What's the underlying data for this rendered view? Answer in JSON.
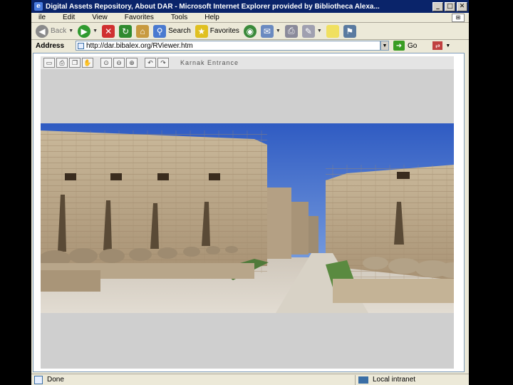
{
  "window": {
    "title": "Digital Assets Repository, About DAR - Microsoft Internet Explorer provided by Bibliotheca Alexa...",
    "minimize_glyph": "_",
    "maximize_glyph": "□",
    "close_glyph": "✕"
  },
  "menu": {
    "items": [
      "ile",
      "Edit",
      "View",
      "Favorites",
      "Tools",
      "Help"
    ]
  },
  "toolbar": {
    "back_label": "Back",
    "search_label": "Search",
    "favorites_label": "Favorites"
  },
  "address": {
    "label": "Address",
    "value": "http://dar.bibalex.org/RViewer.htm",
    "go_label": "Go"
  },
  "viewer": {
    "title": "Karnak Entrance"
  },
  "status": {
    "text": "Done",
    "zone": "Local intranet"
  },
  "colors": {
    "titlebar": "#0a246a",
    "chrome": "#ece9d8",
    "viewer_bg": "#cfcfcf",
    "sky": "#3a64c6"
  }
}
